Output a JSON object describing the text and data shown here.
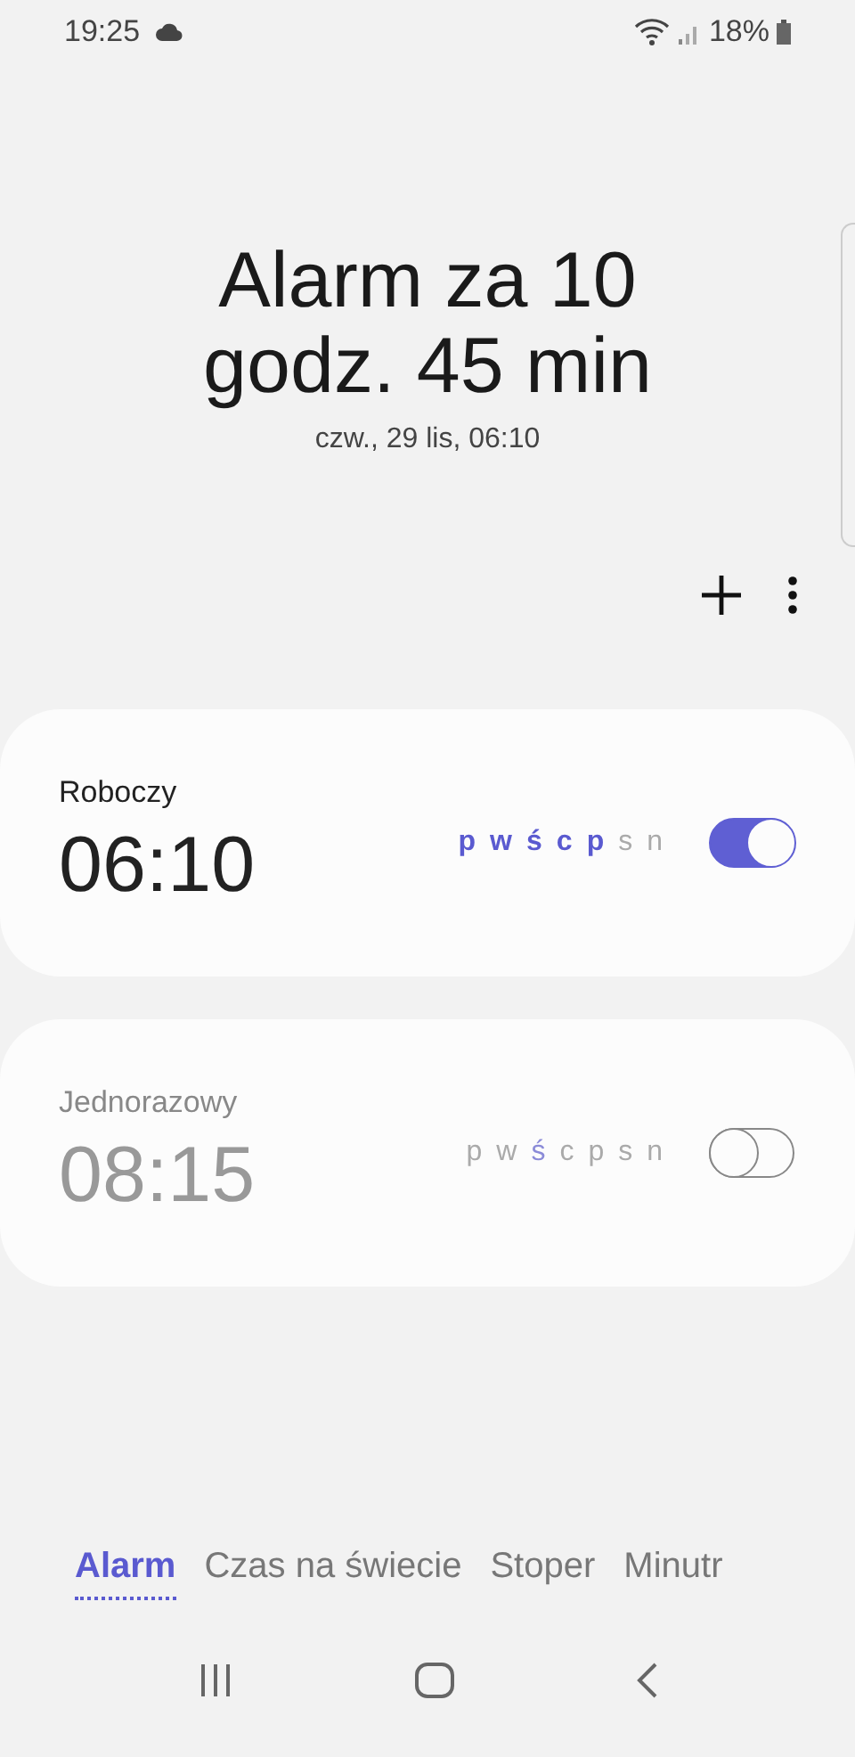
{
  "status_bar": {
    "time": "19:25",
    "battery": "18%"
  },
  "header": {
    "title": "Alarm za 10 godz. 45 min",
    "subtitle": "czw., 29 lis, 06:10"
  },
  "alarms": [
    {
      "name": "Roboczy",
      "time": "06:10",
      "on": true,
      "days": [
        {
          "label": "p",
          "selected": true
        },
        {
          "label": "w",
          "selected": true
        },
        {
          "label": "ś",
          "selected": true
        },
        {
          "label": "c",
          "selected": true
        },
        {
          "label": "p",
          "selected": true
        },
        {
          "label": "s",
          "selected": false
        },
        {
          "label": "n",
          "selected": false
        }
      ]
    },
    {
      "name": "Jednorazowy",
      "time": "08:15",
      "on": false,
      "days": [
        {
          "label": "p",
          "selected": false
        },
        {
          "label": "w",
          "selected": false
        },
        {
          "label": "ś",
          "selected": true
        },
        {
          "label": "c",
          "selected": false
        },
        {
          "label": "p",
          "selected": false
        },
        {
          "label": "s",
          "selected": false
        },
        {
          "label": "n",
          "selected": false
        }
      ]
    }
  ],
  "tabs": [
    {
      "label": "Alarm",
      "selected": true
    },
    {
      "label": "Czas na świecie",
      "selected": false
    },
    {
      "label": "Stoper",
      "selected": false
    },
    {
      "label": "Minutr",
      "selected": false
    }
  ]
}
